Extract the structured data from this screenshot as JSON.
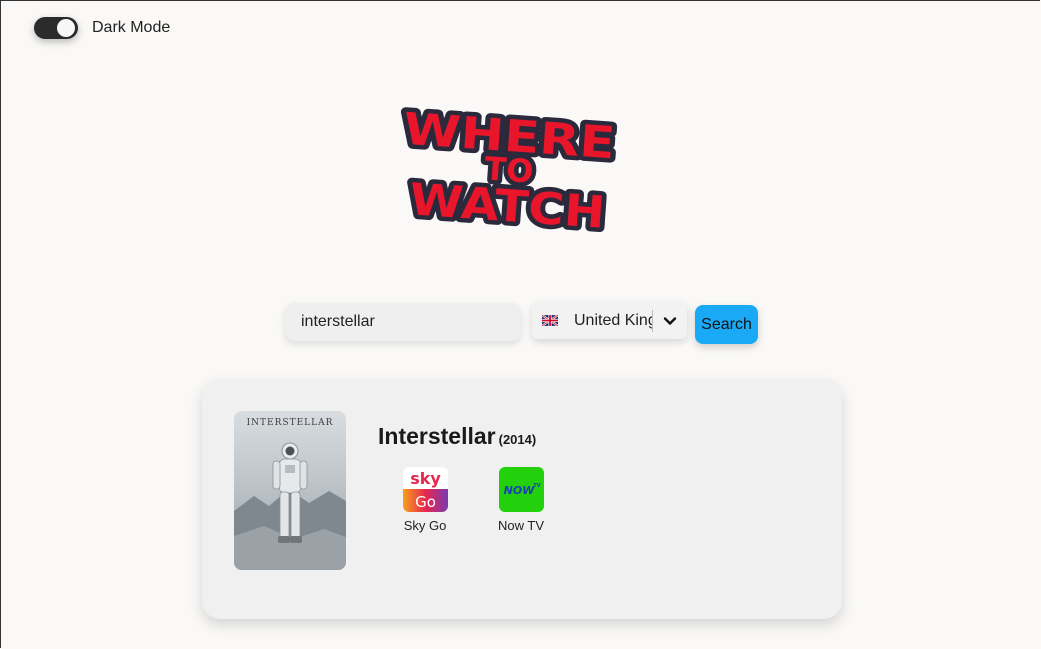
{
  "header": {
    "dark_mode_label": "Dark Mode",
    "dark_mode_on": true
  },
  "logo": {
    "lines": [
      "WHERE",
      "TO",
      "WATCH"
    ],
    "fill_color": "#e8152b",
    "outline_color": "#2a2a3c"
  },
  "search": {
    "query_value": "interstellar",
    "country_value": "United Kingdom",
    "country_flag": "uk-flag-icon",
    "button_label": "Search",
    "button_color": "#1aa9f5"
  },
  "result": {
    "title": "Interstellar",
    "year": "(2014)",
    "poster_text": "INTERSTELLAR",
    "providers": [
      {
        "name": "Sky Go",
        "icon": "sky-go-icon",
        "icon_top_text": "sky",
        "icon_bottom_text": "Go"
      },
      {
        "name": "Now TV",
        "icon": "now-tv-icon",
        "icon_text": "NOW",
        "icon_superscript": "TV",
        "icon_color": "#22d00c"
      }
    ]
  }
}
